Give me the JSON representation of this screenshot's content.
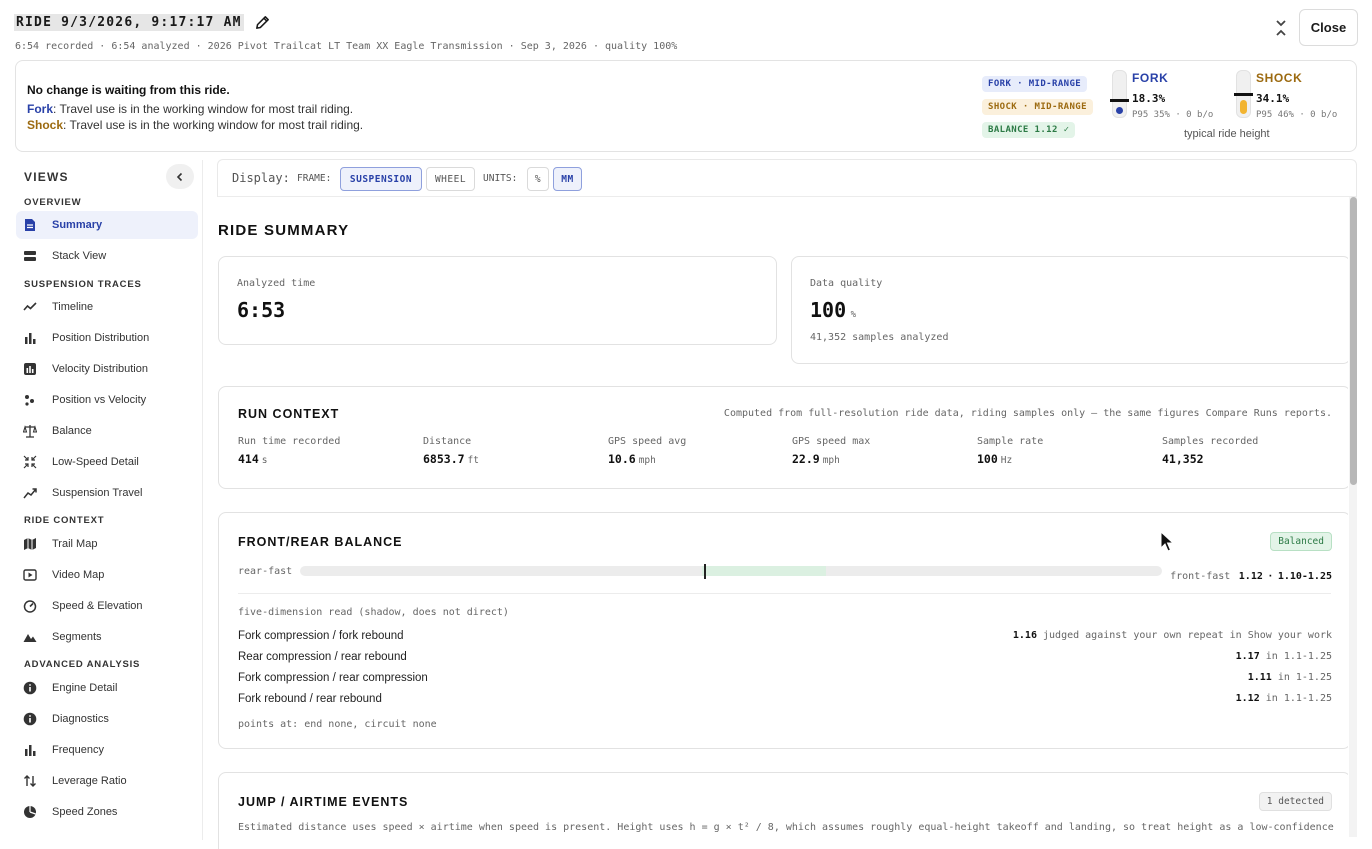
{
  "header": {
    "title": "RIDE 9/3/2026, 9:17:17 AM",
    "subtitle": "6:54 recorded · 6:54 analyzed · 2026 Pivot Trailcat LT Team XX Eagle Transmission · Sep 3, 2026 · quality 100%",
    "close_label": "Close"
  },
  "banner": {
    "message": "No change is waiting from this ride.",
    "fork_label": "Fork",
    "fork_text": ": Travel use is in the working window for most trail riding.",
    "shock_label": "Shock",
    "shock_text": ": Travel use is in the working window for most trail riding.",
    "pills": {
      "fork": "FORK · MID-RANGE",
      "shock": "SHOCK · MID-RANGE",
      "balance": "BALANCE 1.12 ✓"
    },
    "fork": {
      "name": "FORK",
      "value": "18.3%",
      "p95": "P95 35% · 0 b/o",
      "level": 18.3
    },
    "shock": {
      "name": "SHOCK",
      "value": "34.1%",
      "p95": "P95 46% · 0 b/o",
      "level": 34.1
    },
    "typical": "typical ride height"
  },
  "colors": {
    "fork": "#2941a8",
    "shock": "#9c6a10",
    "shock_fill": "#f2b430",
    "accent_bg": "#eef1fb",
    "balance_green": "#2c7a45"
  },
  "sidebar": {
    "title": "VIEWS",
    "sections": [
      {
        "label": "OVERVIEW"
      },
      {
        "label": "SUSPENSION TRACES"
      },
      {
        "label": "RIDE CONTEXT"
      },
      {
        "label": "ADVANCED ANALYSIS"
      }
    ],
    "items": [
      {
        "label": "Summary",
        "icon": "document-icon"
      },
      {
        "label": "Stack View",
        "icon": "stack-icon"
      },
      {
        "label": "Timeline",
        "icon": "trend-line-icon"
      },
      {
        "label": "Position Distribution",
        "icon": "bar-chart-icon"
      },
      {
        "label": "Velocity Distribution",
        "icon": "square-bar-chart-icon"
      },
      {
        "label": "Position vs Velocity",
        "icon": "scatter-dots-icon"
      },
      {
        "label": "Balance",
        "icon": "scale-icon"
      },
      {
        "label": "Low-Speed Detail",
        "icon": "collapse-arrows-icon"
      },
      {
        "label": "Suspension Travel",
        "icon": "trend-up-icon"
      },
      {
        "label": "Trail Map",
        "icon": "map-icon"
      },
      {
        "label": "Video Map",
        "icon": "play-icon"
      },
      {
        "label": "Speed & Elevation",
        "icon": "gauge-icon"
      },
      {
        "label": "Segments",
        "icon": "mountain-icon"
      },
      {
        "label": "Engine Detail",
        "icon": "info-icon"
      },
      {
        "label": "Diagnostics",
        "icon": "info-icon"
      },
      {
        "label": "Frequency",
        "icon": "bar-chart-icon"
      },
      {
        "label": "Leverage Ratio",
        "icon": "up-down-arrows-icon"
      },
      {
        "label": "Speed Zones",
        "icon": "pie-icon"
      }
    ]
  },
  "display": {
    "label": "Display:",
    "frame_label": "FRAME:",
    "frame_options": [
      "SUSPENSION",
      "WHEEL"
    ],
    "units_label": "UNITS:",
    "units_options": [
      "%",
      "MM"
    ]
  },
  "summary": {
    "title": "RIDE SUMMARY",
    "analyzed_label": "Analyzed time",
    "analyzed_value": "6:53",
    "quality_label": "Data quality",
    "quality_value": "100",
    "quality_unit": "%",
    "quality_note": "41,352 samples analyzed"
  },
  "run_context": {
    "title": "RUN CONTEXT",
    "note": "Computed from full-resolution ride data, riding samples only — the same figures Compare Runs reports.",
    "stats": [
      {
        "label": "Run time recorded",
        "value": "414",
        "unit": "s"
      },
      {
        "label": "Distance",
        "value": "6853.7",
        "unit": "ft"
      },
      {
        "label": "GPS speed avg",
        "value": "10.6",
        "unit": "mph"
      },
      {
        "label": "GPS speed max",
        "value": "22.9",
        "unit": "mph"
      },
      {
        "label": "Sample rate",
        "value": "100",
        "unit": "Hz"
      },
      {
        "label": "Samples recorded",
        "value": "41,352",
        "unit": ""
      }
    ]
  },
  "balance": {
    "title": "FRONT/REAR BALANCE",
    "badge": "Balanced",
    "left_label": "rear-fast",
    "right_label": "front-fast",
    "value": "1.12",
    "range_sep": "·",
    "range": "1.10-1.25",
    "marker_fraction": 0.47,
    "five_dim": "five-dimension read (shadow, does not direct)",
    "rows": [
      {
        "label": "Fork compression / fork rebound",
        "value": "1.16",
        "note": "judged against your own repeat in Show your work"
      },
      {
        "label": "Rear compression / rear rebound",
        "value": "1.17",
        "note": "in 1.1-1.25"
      },
      {
        "label": "Fork compression / rear compression",
        "value": "1.11",
        "note": "in 1-1.25"
      },
      {
        "label": "Fork rebound / rear rebound",
        "value": "1.12",
        "note": "in 1.1-1.25"
      }
    ],
    "points": "points at: end none, circuit none"
  },
  "jumps": {
    "title": "JUMP / AIRTIME EVENTS",
    "badge": "1 detected",
    "note": "Estimated distance uses speed × airtime when speed is present. Height uses h = g × t² / 8, which assumes roughly equal-height takeoff and landing, so treat height as a low-confidence"
  }
}
